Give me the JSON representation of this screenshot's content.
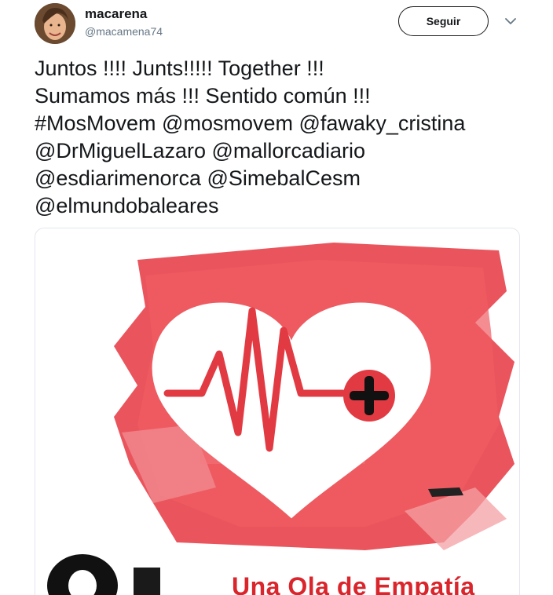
{
  "author": {
    "name": "macarena",
    "handle": "@macamena74"
  },
  "actions": {
    "follow_label": "Seguir",
    "more_icon": "chevron-down-icon"
  },
  "tweet": {
    "lines": [
      "Juntos !!!! Junts!!!!! Together !!!",
      "Sumamos más !!! Sentido común !!!",
      "#MosMovem @mosmovem @fawaky_cristina",
      "@DrMiguelLazaro @mallorcadiario",
      "@esdiarimenorca @SimebalCesm",
      "@elmundobaleares"
    ]
  },
  "media": {
    "caption": "Una Ola de Empatía",
    "icons": [
      "heart-icon",
      "heartbeat-icon",
      "plus-icon"
    ],
    "colors": {
      "splash": "#e8474f",
      "heart": "#ffffff",
      "pulse": "#e23a42",
      "plus_circle": "#e23a42",
      "plus": "#111111"
    }
  }
}
